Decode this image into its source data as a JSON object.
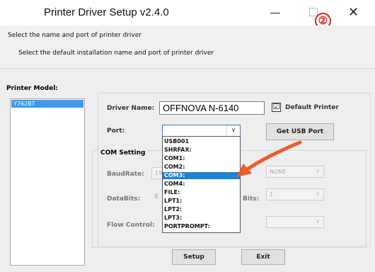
{
  "window": {
    "title": "Printer Driver Setup v2.4.0",
    "minimize_symbol": "—",
    "close_symbol": "✕",
    "step_badge": "②"
  },
  "header": {
    "line1": "Select the name and port of printer driver",
    "line2": "Select the default installation name and port of printer driver"
  },
  "printer_model": {
    "label": "Printer Model:",
    "items": [
      "Y762BT"
    ]
  },
  "driver": {
    "name_label": "Driver Name:",
    "name_value": "OFFNOVA N-6140",
    "default_label": "Default Printer",
    "default_checked": "☑"
  },
  "port": {
    "label": "Port:",
    "value": "",
    "caret": "∨",
    "get_usb_label": "Get USB Port",
    "options": [
      "USB001",
      "SHRFAX:",
      "COM1:",
      "COM2:",
      "COM3:",
      "COM4:",
      "FILE:",
      "LPT1:",
      "LPT2:",
      "LPT3:",
      "PORTPROMPT:"
    ],
    "selected_option": "COM3:"
  },
  "com": {
    "group_label": "COM Setting",
    "baud_label": "BaudRate:",
    "baud_value": "19",
    "parity_value": "NONE",
    "databits_label": "DataBits:",
    "databits_value": "8",
    "stopbits_label": "Bits:",
    "stopbits_value": "1",
    "flow_label": "Flow Control:",
    "caret": "∨"
  },
  "buttons": {
    "setup": "Setup",
    "exit": "Exit"
  },
  "colors": {
    "accent": "#1e82d7",
    "arrow": "#f05a28",
    "badge": "#dd2222"
  }
}
